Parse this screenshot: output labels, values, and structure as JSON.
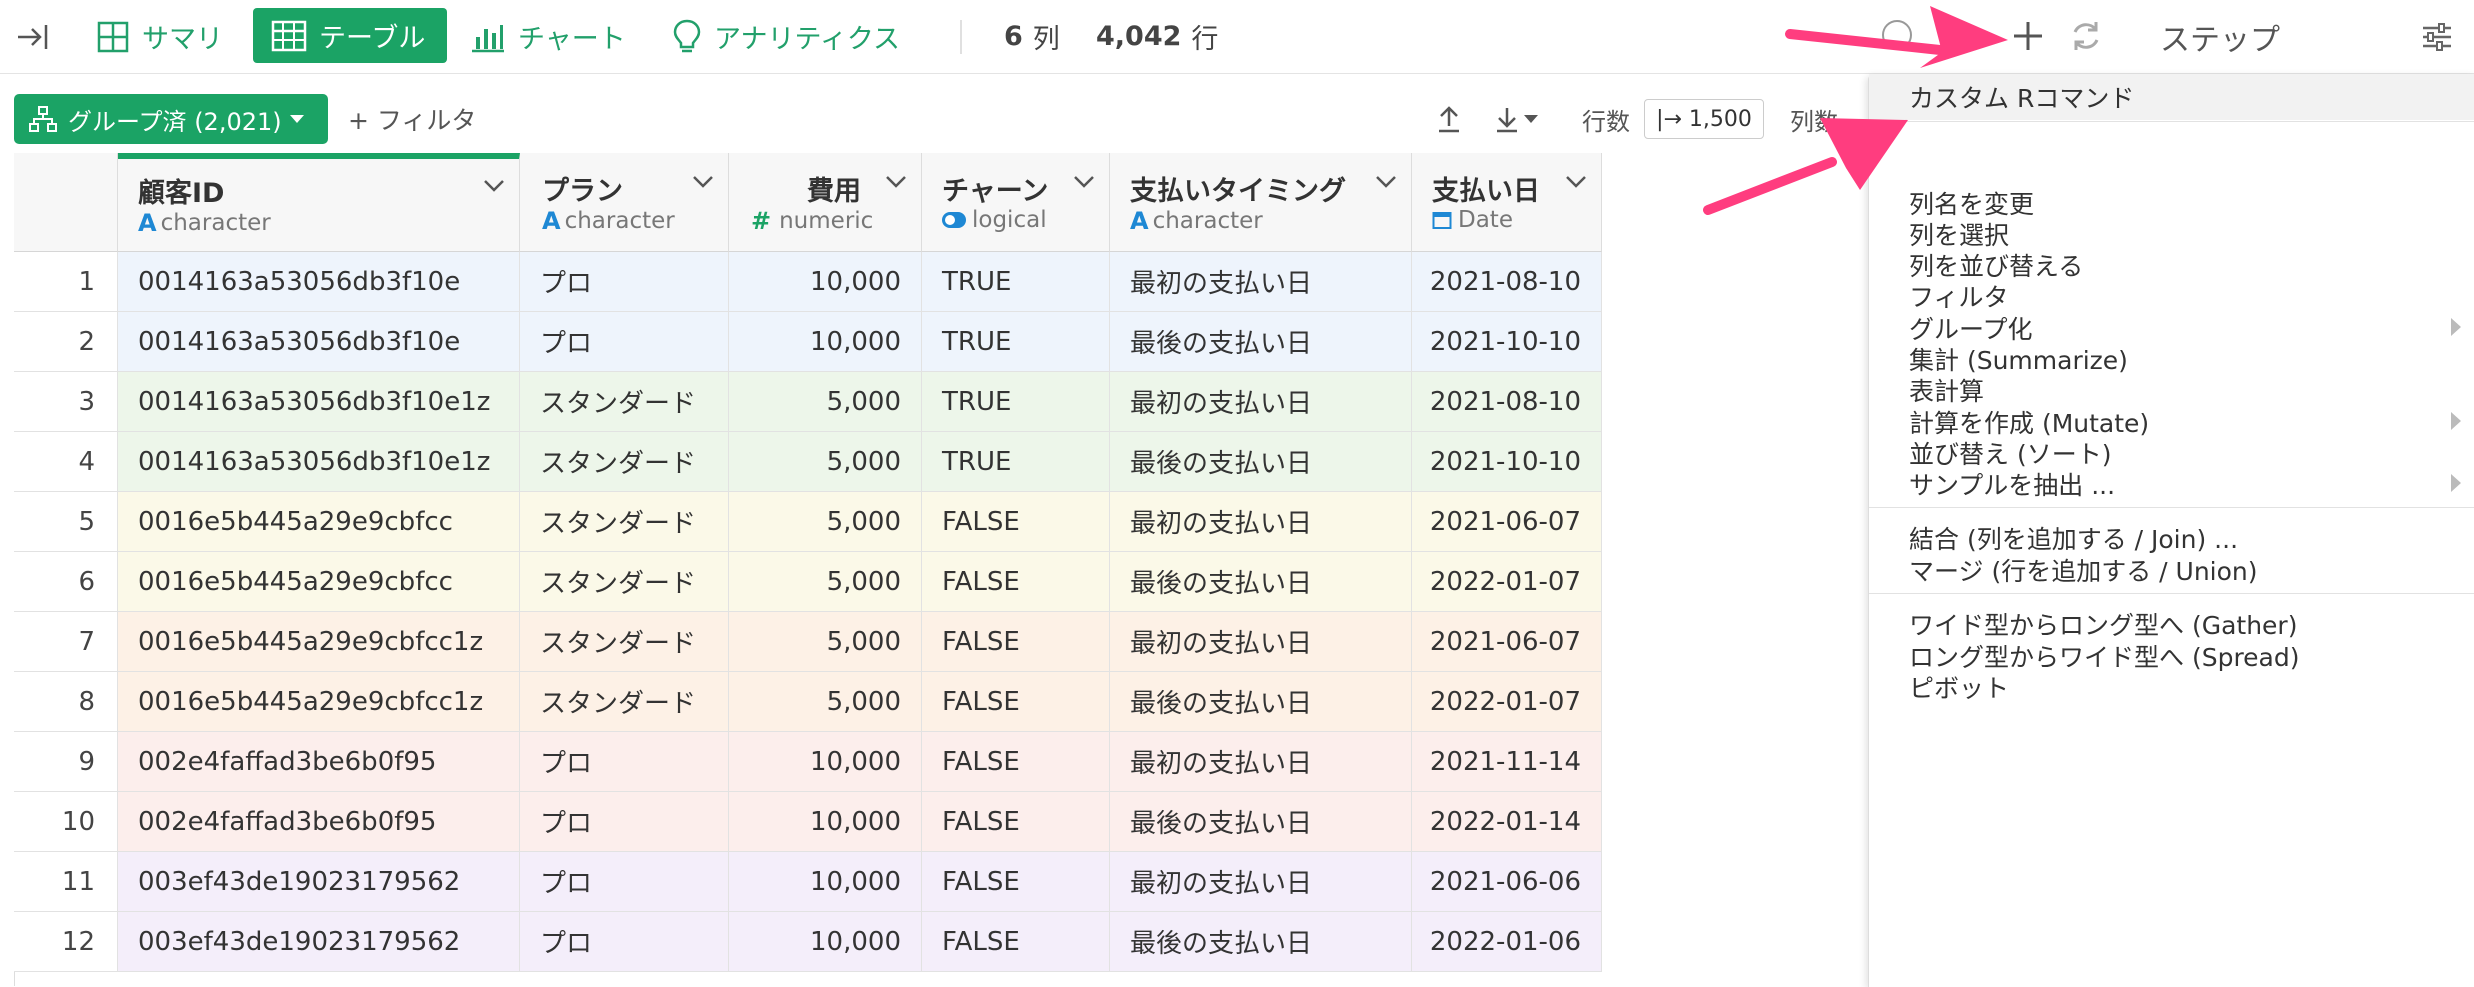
{
  "toolbar": {
    "tabs": [
      {
        "label": "サマリ",
        "icon": "summary-grid-icon"
      },
      {
        "label": "テーブル",
        "icon": "table-icon"
      },
      {
        "label": "チャート",
        "icon": "chart-icon"
      },
      {
        "label": "アナリティクス",
        "icon": "lightbulb-icon"
      }
    ],
    "columns_count": "6",
    "columns_unit": "列",
    "rows_count": "4,042",
    "rows_unit": "行",
    "steps_label": "ステップ"
  },
  "subbar": {
    "group_label": "グループ済 (2,021)",
    "filter_label": "+ フィルタ",
    "rows_label": "行数",
    "rows_value": "|→ 1,500",
    "cols_label": "列数"
  },
  "table": {
    "columns": [
      {
        "name": "顧客ID",
        "type": "character",
        "type_icon": "A"
      },
      {
        "name": "プラン",
        "type": "character",
        "type_icon": "A"
      },
      {
        "name": "費用",
        "type": "numeric",
        "type_icon": "#"
      },
      {
        "name": "チャーン",
        "type": "logical",
        "type_icon": "toggle"
      },
      {
        "name": "支払いタイミング",
        "type": "character",
        "type_icon": "A"
      },
      {
        "name": "支払い日",
        "type": "Date",
        "type_icon": "calendar"
      }
    ],
    "rows": [
      {
        "n": "1",
        "id": "0014163a53056db3f10e",
        "plan": "プロ",
        "cost": "10,000",
        "churn": "TRUE",
        "timing": "最初の支払い日",
        "date": "2021-08-10"
      },
      {
        "n": "2",
        "id": "0014163a53056db3f10e",
        "plan": "プロ",
        "cost": "10,000",
        "churn": "TRUE",
        "timing": "最後の支払い日",
        "date": "2021-10-10"
      },
      {
        "n": "3",
        "id": "0014163a53056db3f10e1z",
        "plan": "スタンダード",
        "cost": "5,000",
        "churn": "TRUE",
        "timing": "最初の支払い日",
        "date": "2021-08-10"
      },
      {
        "n": "4",
        "id": "0014163a53056db3f10e1z",
        "plan": "スタンダード",
        "cost": "5,000",
        "churn": "TRUE",
        "timing": "最後の支払い日",
        "date": "2021-10-10"
      },
      {
        "n": "5",
        "id": "0016e5b445a29e9cbfcc",
        "plan": "スタンダード",
        "cost": "5,000",
        "churn": "FALSE",
        "timing": "最初の支払い日",
        "date": "2021-06-07"
      },
      {
        "n": "6",
        "id": "0016e5b445a29e9cbfcc",
        "plan": "スタンダード",
        "cost": "5,000",
        "churn": "FALSE",
        "timing": "最後の支払い日",
        "date": "2022-01-07"
      },
      {
        "n": "7",
        "id": "0016e5b445a29e9cbfcc1z",
        "plan": "スタンダード",
        "cost": "5,000",
        "churn": "FALSE",
        "timing": "最初の支払い日",
        "date": "2021-06-07"
      },
      {
        "n": "8",
        "id": "0016e5b445a29e9cbfcc1z",
        "plan": "スタンダード",
        "cost": "5,000",
        "churn": "FALSE",
        "timing": "最後の支払い日",
        "date": "2022-01-07"
      },
      {
        "n": "9",
        "id": "002e4faffad3be6b0f95",
        "plan": "プロ",
        "cost": "10,000",
        "churn": "FALSE",
        "timing": "最初の支払い日",
        "date": "2021-11-14"
      },
      {
        "n": "10",
        "id": "002e4faffad3be6b0f95",
        "plan": "プロ",
        "cost": "10,000",
        "churn": "FALSE",
        "timing": "最後の支払い日",
        "date": "2022-01-14"
      },
      {
        "n": "11",
        "id": "003ef43de19023179562",
        "plan": "プロ",
        "cost": "10,000",
        "churn": "FALSE",
        "timing": "最初の支払い日",
        "date": "2021-06-06"
      },
      {
        "n": "12",
        "id": "003ef43de19023179562",
        "plan": "プロ",
        "cost": "10,000",
        "churn": "FALSE",
        "timing": "最後の支払い日",
        "date": "2022-01-06"
      }
    ],
    "group_colors": [
      "#eef4fc",
      "#edf6ea",
      "#fbf9e8",
      "#fdf1e6",
      "#fceeec",
      "#f4eefa"
    ]
  },
  "menu": {
    "items": [
      {
        "label": "カスタム Rコマンド",
        "sub": false,
        "highlight": true
      },
      {
        "label": "列名を変更",
        "sub": false
      },
      {
        "label": "列を選択",
        "sub": false
      },
      {
        "label": "列を並び替える",
        "sub": false
      },
      {
        "label": "フィルタ",
        "sub": false
      },
      {
        "label": "グループ化",
        "sub": true
      },
      {
        "label": "集計 (Summarize)",
        "sub": false
      },
      {
        "label": "表計算",
        "sub": false
      },
      {
        "label": "計算を作成 (Mutate)",
        "sub": true
      },
      {
        "label": "並び替え (ソート)",
        "sub": false
      },
      {
        "label": "サンプルを抽出 ...",
        "sub": true
      },
      {
        "label": "結合 (列を追加する / Join) ...",
        "sub": false
      },
      {
        "label": "マージ (行を追加する / Union)",
        "sub": false
      },
      {
        "label": "ワイド型からロング型へ (Gather)",
        "sub": false
      },
      {
        "label": "ロング型からワイド型へ (Spread)",
        "sub": false
      },
      {
        "label": "ピボット",
        "sub": false
      }
    ]
  },
  "colors": {
    "accent": "#1ba365",
    "arrow": "#ff3d7f"
  }
}
